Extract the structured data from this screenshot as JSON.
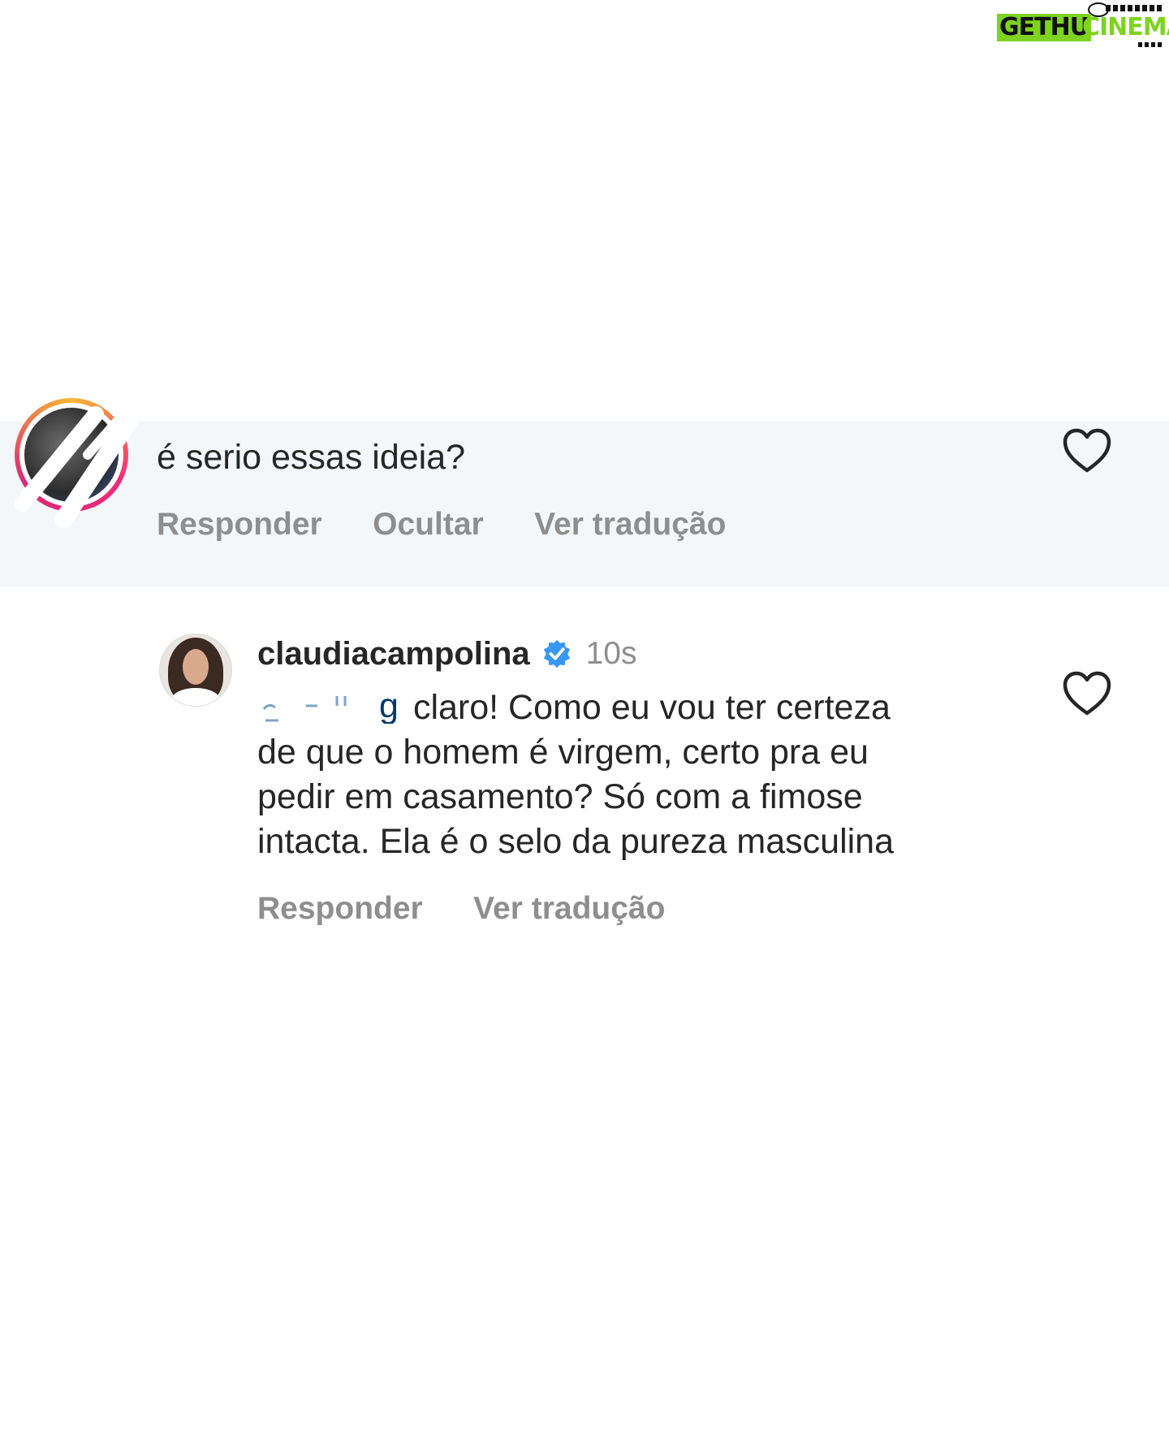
{
  "watermark": {
    "part_1": "GETHU",
    "part_2": "CINEMA"
  },
  "comment_1": {
    "text": "é serio essas ideia?",
    "actions": [
      "Responder",
      "Ocultar",
      "Ver tradução"
    ],
    "like_icon": "heart-outline-icon"
  },
  "comment_2": {
    "username": "claudiacampolina",
    "verified_icon": "verified-badge-icon",
    "timestamp": "10s",
    "mention_redacted": true,
    "lines": [
      "claro! Como eu vou ter certeza",
      "de que o homem é virgem, certo pra eu",
      "pedir em casamento? Só com a fimose",
      "intacta. Ela é o selo da pureza masculina"
    ],
    "actions": [
      "Responder",
      "Ver tradução"
    ],
    "like_icon": "heart-outline-icon"
  },
  "colors": {
    "highlight_bg": "#f3f7f9",
    "secondary_text": "#8e8e8e",
    "primary_text": "#262626",
    "verified_blue": "#3897f0",
    "watermark_green": "#7ed321"
  }
}
